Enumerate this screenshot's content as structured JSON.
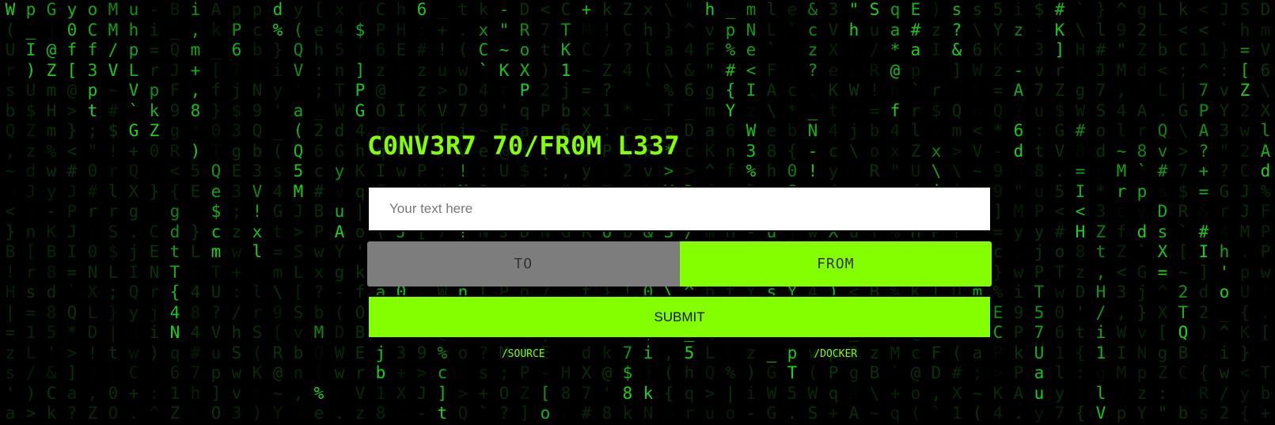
{
  "title": "C0NV3R7 70/FR0M L337",
  "input": {
    "placeholder": "Your text here",
    "value": ""
  },
  "direction": {
    "options": [
      "TO",
      "FROM"
    ],
    "selected": "FROM"
  },
  "submit_label": "SUBMIT",
  "links": [
    {
      "label": "/SOURCE"
    },
    {
      "label": "/DOCKER"
    }
  ],
  "colors": {
    "accent": "#84ff00",
    "matrix_bright": "#1bd11b",
    "matrix_dim": "#0f4a0f",
    "toggle_inactive": "#7d7d7d",
    "background": "#000000"
  }
}
